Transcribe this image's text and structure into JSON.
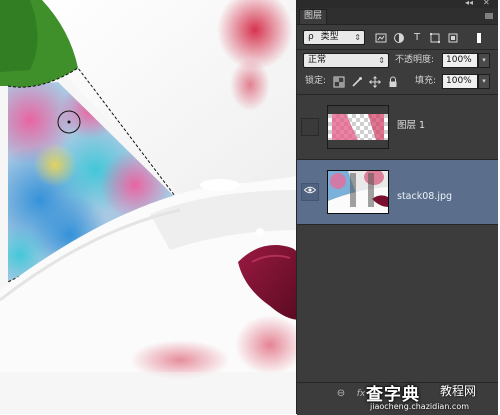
{
  "panel": {
    "tab_label": "图层",
    "topbar_controls": "◂◂",
    "topbar_close": "✕",
    "menu_icon": "panel-menu-icon",
    "filter": {
      "kind_label": "类型",
      "search_glyph": "ρ"
    },
    "blend_mode": "正常",
    "opacity_label": "不透明度:",
    "opacity_value": "100%",
    "lock_label": "锁定:",
    "fill_label": "填充:",
    "fill_value": "100%",
    "layers": [
      {
        "name": "图层 1",
        "visible": false,
        "selected": false
      },
      {
        "name": "stack08.jpg",
        "visible": true,
        "selected": true
      }
    ],
    "bottom_icons": [
      "link-icon",
      "fx-icon",
      "mask-icon",
      "adjustment-icon",
      "folder-icon",
      "new-layer-icon",
      "trash-icon"
    ],
    "bottom_link_glyph": "⊖",
    "bottom_fx_glyph": "fx"
  },
  "canvas": {
    "brush_cursor": "brush-cursor"
  },
  "watermark": {
    "brand": "查字典",
    "site": "教程网",
    "url": "jiaocheng.chazidian.com"
  },
  "colors": {
    "panel_bg": "#3c3c3c",
    "selected_layer": "#5b6f8c",
    "petal_red": "#c4203e",
    "stamen_maroon": "#7a1030"
  }
}
